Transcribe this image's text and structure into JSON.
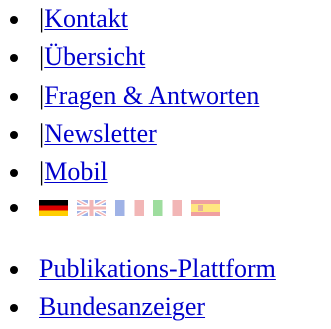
{
  "nav_top": {
    "separator": "|",
    "items": [
      {
        "label": "Kontakt"
      },
      {
        "label": "Übersicht"
      },
      {
        "label": "Fragen & Antworten"
      },
      {
        "label": "Newsletter"
      },
      {
        "label": "Mobil"
      }
    ]
  },
  "languages": {
    "flags": [
      {
        "icon": "flag-germany-icon"
      },
      {
        "icon": "flag-uk-icon"
      },
      {
        "icon": "flag-france-icon"
      },
      {
        "icon": "flag-italy-icon"
      },
      {
        "icon": "flag-spain-icon"
      }
    ]
  },
  "nav_bottom": {
    "items": [
      {
        "label": "Publikations-Plattform"
      },
      {
        "label": "Bundesanzeiger"
      }
    ]
  },
  "colors": {
    "link": "#0000cc",
    "text": "#000000",
    "background": "#ffffff"
  }
}
